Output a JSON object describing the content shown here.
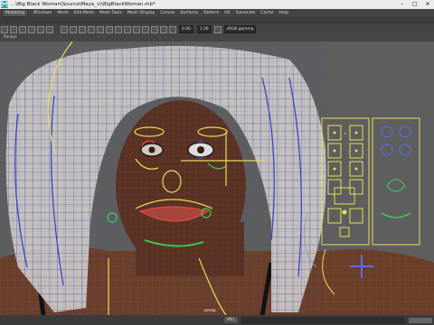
{
  "window": {
    "title": "...\\Big Black Woman\\Source\\Maya_v\\\\BigBlackWoman.mb*",
    "minimize": "–",
    "maximize": "□",
    "close": "✕"
  },
  "menubar": {
    "workspace": "Modeling",
    "items": [
      "Windows",
      "Mesh",
      "Edit Mesh",
      "Mesh Tools",
      "Mesh Display",
      "Curves",
      "Surfaces",
      "Deform",
      "UV",
      "Generate",
      "Cache",
      "Help"
    ]
  },
  "status_line": {
    "field_1": "0.00",
    "field_2": "1.00",
    "color_space": "sRGB gamma"
  },
  "panel": {
    "label": "Persps"
  },
  "viewport": {
    "camera_label": "persp"
  },
  "command_line": {
    "mode": "MEL"
  },
  "colors": {
    "viewport_bg": "#5e5e5e",
    "wire_blue": "#2b3fc4",
    "hair": "#d6d3cf",
    "skin": "#5a3120",
    "control_yellow": "#e8dc5a",
    "control_green": "#3dcc5a",
    "control_blue": "#5b6ee8",
    "control_red": "#e04848"
  }
}
